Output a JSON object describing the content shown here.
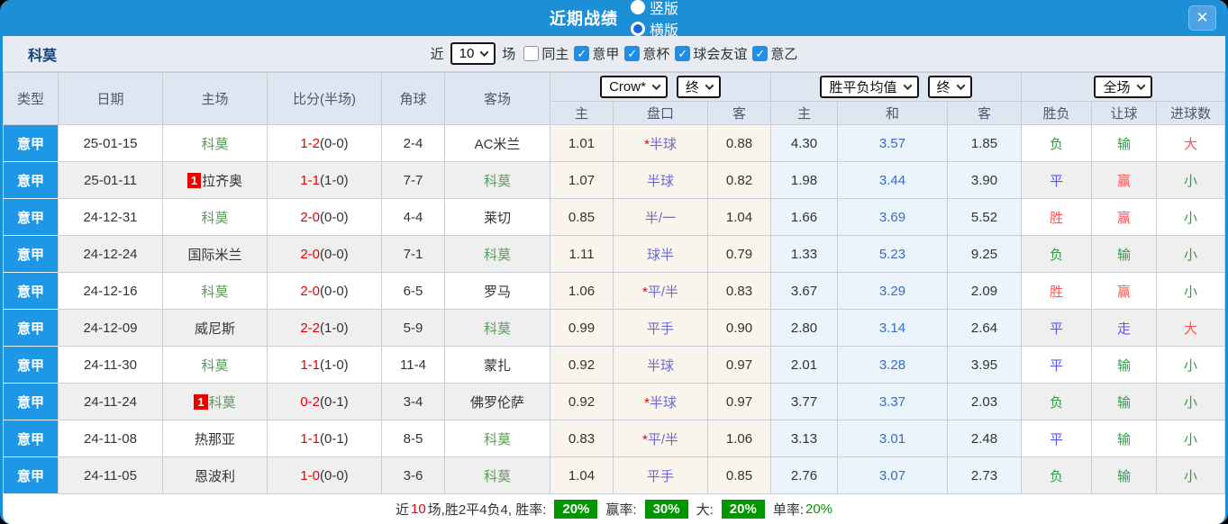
{
  "window": {
    "title": "近期战绩",
    "radios": [
      {
        "label": "竖版",
        "selected": false
      },
      {
        "label": "横版",
        "selected": true
      }
    ],
    "close_icon": "✕"
  },
  "filter": {
    "team": "科莫",
    "recent_label": "近",
    "recent_value": "10",
    "recent_suffix": "场",
    "checkboxes": [
      {
        "label": "同主",
        "checked": false
      },
      {
        "label": "意甲",
        "checked": true
      },
      {
        "label": "意杯",
        "checked": true
      },
      {
        "label": "球会友谊",
        "checked": true
      },
      {
        "label": "意乙",
        "checked": true
      }
    ]
  },
  "table": {
    "static_headers": [
      "类型",
      "日期",
      "主场",
      "比分(半场)",
      "角球",
      "客场"
    ],
    "odds_group": {
      "selects": [
        "Crow*",
        "终"
      ],
      "subheaders": [
        "主",
        "盘口",
        "客"
      ]
    },
    "avg_group": {
      "selects": [
        "胜平负均值",
        "终"
      ],
      "subheaders": [
        "主",
        "和",
        "客"
      ]
    },
    "full_group": {
      "selects": [
        "全场"
      ],
      "subheaders": [
        "胜负",
        "让球",
        "进球数"
      ]
    },
    "rows": [
      {
        "league": "意甲",
        "date": "25-01-15",
        "home": {
          "name": "科莫",
          "highlight": true,
          "badge": ""
        },
        "score": {
          "full": "1-2",
          "half": "(0-0)"
        },
        "corner": "2-4",
        "away": {
          "name": "AC米兰",
          "highlight": false
        },
        "odds": {
          "home": "1.01",
          "handicap": {
            "star": true,
            "text": "半球"
          },
          "away": "0.88"
        },
        "avg": {
          "win": "4.30",
          "draw": "3.57",
          "lose": "1.85"
        },
        "result": {
          "outcome": {
            "text": "负",
            "color": "green"
          },
          "handicap": {
            "text": "输",
            "color": "green"
          },
          "goals": {
            "text": "大",
            "color": "red"
          }
        }
      },
      {
        "league": "意甲",
        "date": "25-01-11",
        "home": {
          "name": "拉齐奥",
          "highlight": false,
          "badge": "1"
        },
        "score": {
          "full": "1-1",
          "half": "(1-0)"
        },
        "corner": "7-7",
        "away": {
          "name": "科莫",
          "highlight": true
        },
        "odds": {
          "home": "1.07",
          "handicap": {
            "star": false,
            "text": "半球"
          },
          "away": "0.82"
        },
        "avg": {
          "win": "1.98",
          "draw": "3.44",
          "lose": "3.90"
        },
        "result": {
          "outcome": {
            "text": "平",
            "color": "blue"
          },
          "handicap": {
            "text": "赢",
            "color": "red"
          },
          "goals": {
            "text": "小",
            "color": "green"
          }
        }
      },
      {
        "league": "意甲",
        "date": "24-12-31",
        "home": {
          "name": "科莫",
          "highlight": true,
          "badge": ""
        },
        "score": {
          "full": "2-0",
          "half": "(0-0)"
        },
        "corner": "4-4",
        "away": {
          "name": "莱切",
          "highlight": false
        },
        "odds": {
          "home": "0.85",
          "handicap": {
            "star": false,
            "text": "半/一"
          },
          "away": "1.04"
        },
        "avg": {
          "win": "1.66",
          "draw": "3.69",
          "lose": "5.52"
        },
        "result": {
          "outcome": {
            "text": "胜",
            "color": "red"
          },
          "handicap": {
            "text": "赢",
            "color": "red"
          },
          "goals": {
            "text": "小",
            "color": "green"
          }
        }
      },
      {
        "league": "意甲",
        "date": "24-12-24",
        "home": {
          "name": "国际米兰",
          "highlight": false,
          "badge": ""
        },
        "score": {
          "full": "2-0",
          "half": "(0-0)"
        },
        "corner": "7-1",
        "away": {
          "name": "科莫",
          "highlight": true
        },
        "odds": {
          "home": "1.11",
          "handicap": {
            "star": false,
            "text": "球半"
          },
          "away": "0.79"
        },
        "avg": {
          "win": "1.33",
          "draw": "5.23",
          "lose": "9.25"
        },
        "result": {
          "outcome": {
            "text": "负",
            "color": "green"
          },
          "handicap": {
            "text": "输",
            "color": "green"
          },
          "goals": {
            "text": "小",
            "color": "green"
          }
        }
      },
      {
        "league": "意甲",
        "date": "24-12-16",
        "home": {
          "name": "科莫",
          "highlight": true,
          "badge": ""
        },
        "score": {
          "full": "2-0",
          "half": "(0-0)"
        },
        "corner": "6-5",
        "away": {
          "name": "罗马",
          "highlight": false
        },
        "odds": {
          "home": "1.06",
          "handicap": {
            "star": true,
            "text": "平/半"
          },
          "away": "0.83"
        },
        "avg": {
          "win": "3.67",
          "draw": "3.29",
          "lose": "2.09"
        },
        "result": {
          "outcome": {
            "text": "胜",
            "color": "red"
          },
          "handicap": {
            "text": "赢",
            "color": "red"
          },
          "goals": {
            "text": "小",
            "color": "green"
          }
        }
      },
      {
        "league": "意甲",
        "date": "24-12-09",
        "home": {
          "name": "威尼斯",
          "highlight": false,
          "badge": ""
        },
        "score": {
          "full": "2-2",
          "half": "(1-0)"
        },
        "corner": "5-9",
        "away": {
          "name": "科莫",
          "highlight": true
        },
        "odds": {
          "home": "0.99",
          "handicap": {
            "star": false,
            "text": "平手"
          },
          "away": "0.90"
        },
        "avg": {
          "win": "2.80",
          "draw": "3.14",
          "lose": "2.64"
        },
        "result": {
          "outcome": {
            "text": "平",
            "color": "blue"
          },
          "handicap": {
            "text": "走",
            "color": "blue"
          },
          "goals": {
            "text": "大",
            "color": "red"
          }
        }
      },
      {
        "league": "意甲",
        "date": "24-11-30",
        "home": {
          "name": "科莫",
          "highlight": true,
          "badge": ""
        },
        "score": {
          "full": "1-1",
          "half": "(1-0)"
        },
        "corner": "11-4",
        "away": {
          "name": "蒙扎",
          "highlight": false
        },
        "odds": {
          "home": "0.92",
          "handicap": {
            "star": false,
            "text": "半球"
          },
          "away": "0.97"
        },
        "avg": {
          "win": "2.01",
          "draw": "3.28",
          "lose": "3.95"
        },
        "result": {
          "outcome": {
            "text": "平",
            "color": "blue"
          },
          "handicap": {
            "text": "输",
            "color": "green"
          },
          "goals": {
            "text": "小",
            "color": "green"
          }
        }
      },
      {
        "league": "意甲",
        "date": "24-11-24",
        "home": {
          "name": "科莫",
          "highlight": true,
          "badge": "1"
        },
        "score": {
          "full": "0-2",
          "half": "(0-1)"
        },
        "corner": "3-4",
        "away": {
          "name": "佛罗伦萨",
          "highlight": false
        },
        "odds": {
          "home": "0.92",
          "handicap": {
            "star": true,
            "text": "半球"
          },
          "away": "0.97"
        },
        "avg": {
          "win": "3.77",
          "draw": "3.37",
          "lose": "2.03"
        },
        "result": {
          "outcome": {
            "text": "负",
            "color": "green"
          },
          "handicap": {
            "text": "输",
            "color": "green"
          },
          "goals": {
            "text": "小",
            "color": "green"
          }
        }
      },
      {
        "league": "意甲",
        "date": "24-11-08",
        "home": {
          "name": "热那亚",
          "highlight": false,
          "badge": ""
        },
        "score": {
          "full": "1-1",
          "half": "(0-1)"
        },
        "corner": "8-5",
        "away": {
          "name": "科莫",
          "highlight": true
        },
        "odds": {
          "home": "0.83",
          "handicap": {
            "star": true,
            "text": "平/半"
          },
          "away": "1.06"
        },
        "avg": {
          "win": "3.13",
          "draw": "3.01",
          "lose": "2.48"
        },
        "result": {
          "outcome": {
            "text": "平",
            "color": "blue"
          },
          "handicap": {
            "text": "输",
            "color": "green"
          },
          "goals": {
            "text": "小",
            "color": "green"
          }
        }
      },
      {
        "league": "意甲",
        "date": "24-11-05",
        "home": {
          "name": "恩波利",
          "highlight": false,
          "badge": ""
        },
        "score": {
          "full": "1-0",
          "half": "(0-0)"
        },
        "corner": "3-6",
        "away": {
          "name": "科莫",
          "highlight": true
        },
        "odds": {
          "home": "1.04",
          "handicap": {
            "star": false,
            "text": "平手"
          },
          "away": "0.85"
        },
        "avg": {
          "win": "2.76",
          "draw": "3.07",
          "lose": "2.73"
        },
        "result": {
          "outcome": {
            "text": "负",
            "color": "green"
          },
          "handicap": {
            "text": "输",
            "color": "green"
          },
          "goals": {
            "text": "小",
            "color": "green"
          }
        }
      }
    ]
  },
  "summary": {
    "prefix": "近",
    "count": "10",
    "mid": "场,胜2平4负4, 胜率:",
    "win_rate_badge": "20%",
    "label_win": "赢率:",
    "win_badge": "30%",
    "label_big": "大:",
    "big_badge": "20%",
    "label_single": "单率:",
    "single_rate": "20%"
  },
  "colors": {
    "titlebar_blue": "#1d8fd6",
    "league_cell_blue": "#1e97e6",
    "team_green": "#5b9b5b",
    "score_red": "#e60000",
    "handicap_purple": "#6b6bd0",
    "avg_draw_blue": "#3a6cc4",
    "result_red": "#ff5252",
    "result_green": "#2e9e47",
    "result_blue": "#5858ff",
    "odds_bg": "#faf5ec",
    "avg_bg": "#eaf4fa",
    "badge_green": "#009600"
  }
}
